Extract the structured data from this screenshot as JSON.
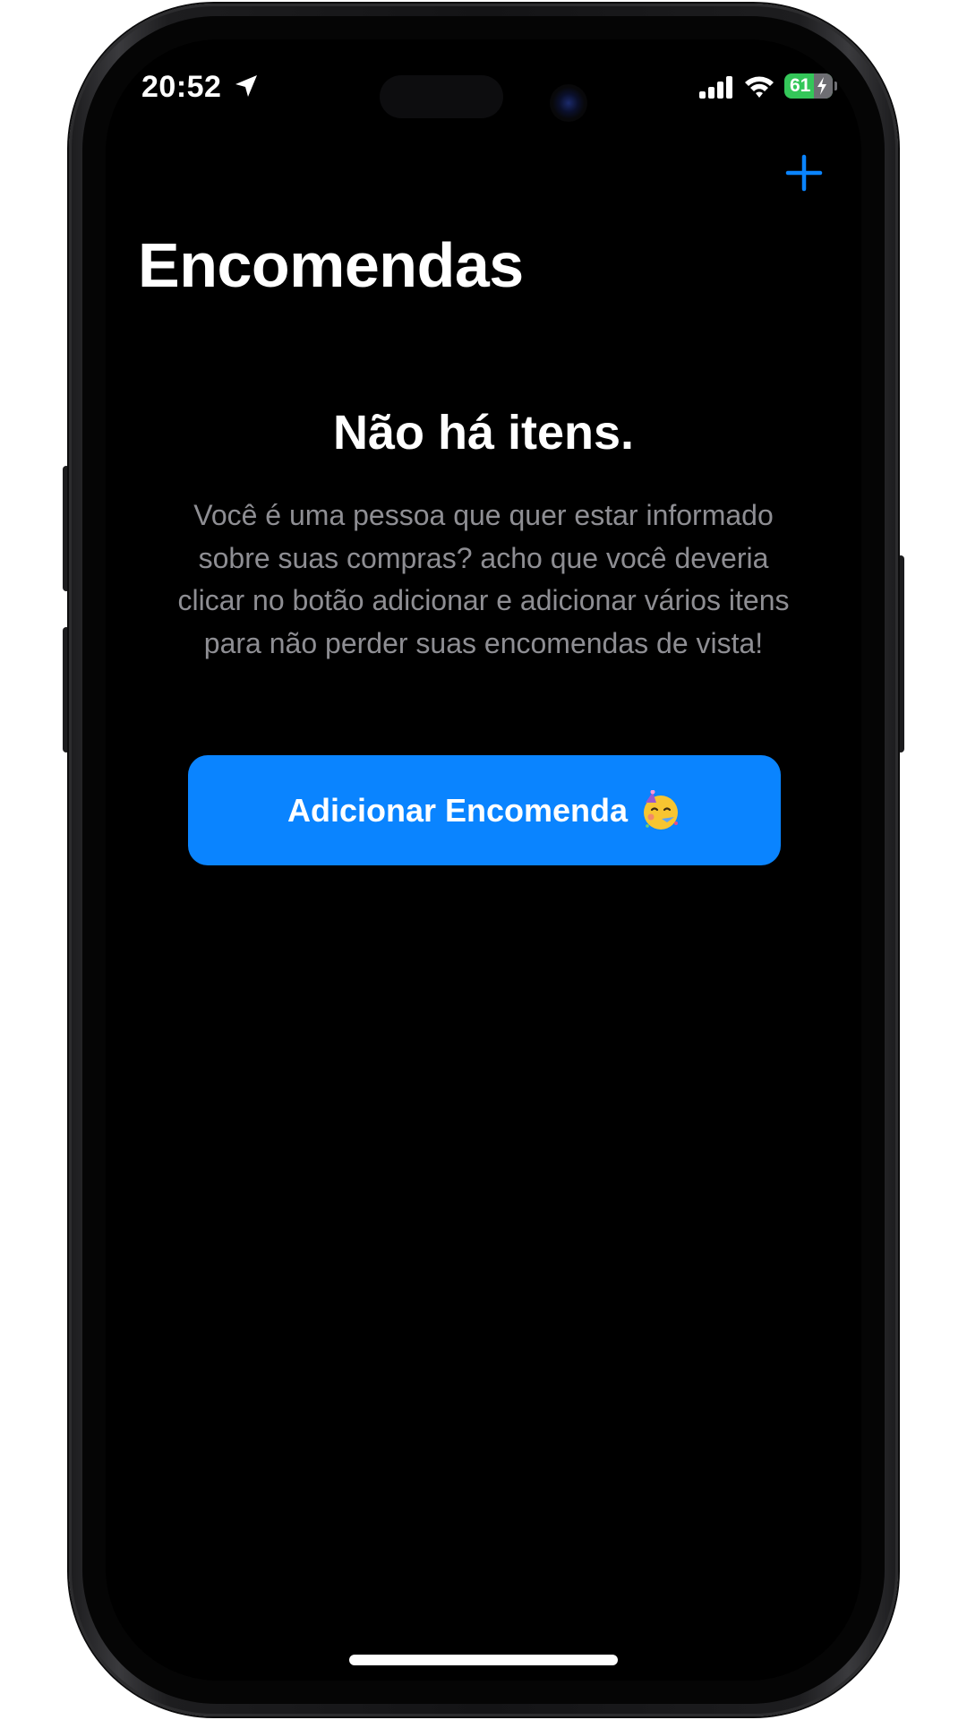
{
  "status_bar": {
    "time": "20:52",
    "battery_level": "61",
    "battery_fraction": 0.61,
    "icons": [
      "location-arrow-icon",
      "cellular-signal-icon",
      "wifi-icon",
      "battery-charging-icon"
    ]
  },
  "nav": {
    "title": "Encomendas",
    "add_icon": "plus-icon"
  },
  "empty_state": {
    "title": "Não há itens.",
    "message": "Você é uma pessoa que quer estar informado sobre suas compras? acho que você deveria clicar no botão adicionar e adicionar vários itens para não perder suas encomendas de vista!",
    "button_label": "Adicionar Encomenda",
    "button_emoji_icon": "partying-face-emoji-icon"
  },
  "colors": {
    "accent": "#0a84ff",
    "background": "#000000",
    "secondary_text": "#8e8e93",
    "battery_green": "#34c759"
  }
}
